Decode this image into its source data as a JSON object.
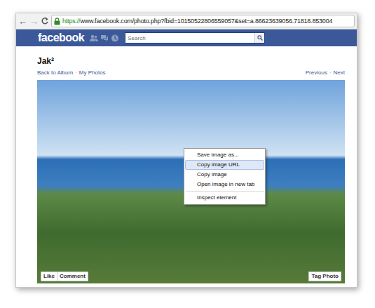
{
  "browser": {
    "back": "←",
    "forward": "→",
    "url_scheme": "https://",
    "url_rest": "www.facebook.com/photo.php?fbid=10150522806559057&set=a.86623639056.71818.853004"
  },
  "header": {
    "logo": "facebook",
    "search_placeholder": "Search"
  },
  "photo_page": {
    "title": "Jak²",
    "separator": "·",
    "nav_left": [
      "Back to Album",
      "My Photos"
    ],
    "nav_right": [
      "Previous",
      "Next"
    ]
  },
  "photo_actions": {
    "like": "Like",
    "comment": "Comment",
    "tag": "Tag Photo"
  },
  "context_menu": {
    "items": [
      {
        "kind": "item",
        "label": "Save image as...",
        "selected": false
      },
      {
        "kind": "item",
        "label": "Copy image URL",
        "selected": true
      },
      {
        "kind": "item",
        "label": "Copy image",
        "selected": false
      },
      {
        "kind": "item",
        "label": "Open image in new tab",
        "selected": false
      },
      {
        "kind": "separator"
      },
      {
        "kind": "item",
        "label": "Inspect element",
        "selected": false
      }
    ]
  }
}
